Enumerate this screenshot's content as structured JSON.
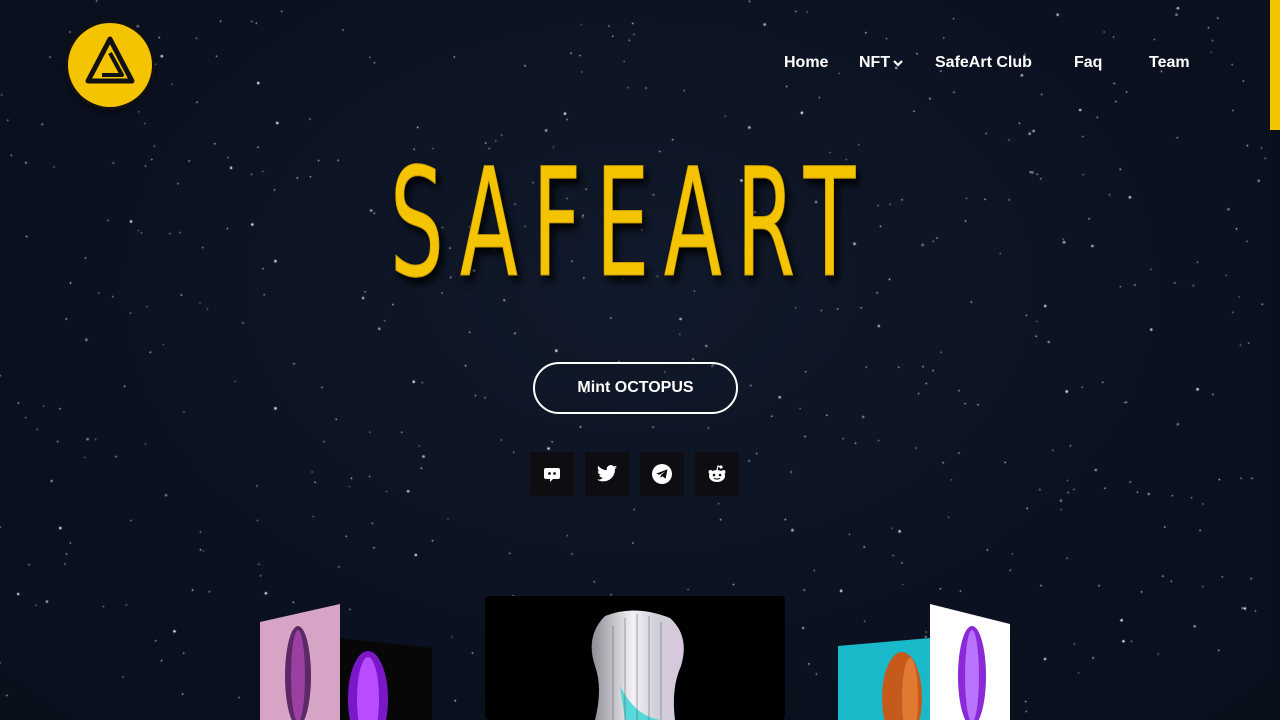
{
  "brand": {
    "logo_icon": "safeart-triangle-logo-icon",
    "accent": "#f5c400"
  },
  "nav": {
    "items": [
      {
        "label": "Home"
      },
      {
        "label": "NFT",
        "icon": "chevron-down-icon"
      },
      {
        "label": "SafeArt Club"
      },
      {
        "label": "Faq"
      },
      {
        "label": "Team"
      }
    ]
  },
  "hero": {
    "title": "SAFEART",
    "cta_label": "Mint OCTOPUS"
  },
  "social": [
    {
      "icon": "discord-icon"
    },
    {
      "icon": "twitter-icon"
    },
    {
      "icon": "telegram-icon"
    },
    {
      "icon": "reddit-icon"
    }
  ],
  "gallery": {
    "cards": [
      {
        "name": "nft-card-left",
        "colors": [
          "#d9a3c8",
          "#0a0a0a"
        ]
      },
      {
        "name": "nft-card-center",
        "colors": [
          "#000000",
          "#e8e8ec"
        ]
      },
      {
        "name": "nft-card-right",
        "colors": [
          "#1ab8c8",
          "#ffffff"
        ]
      }
    ]
  }
}
